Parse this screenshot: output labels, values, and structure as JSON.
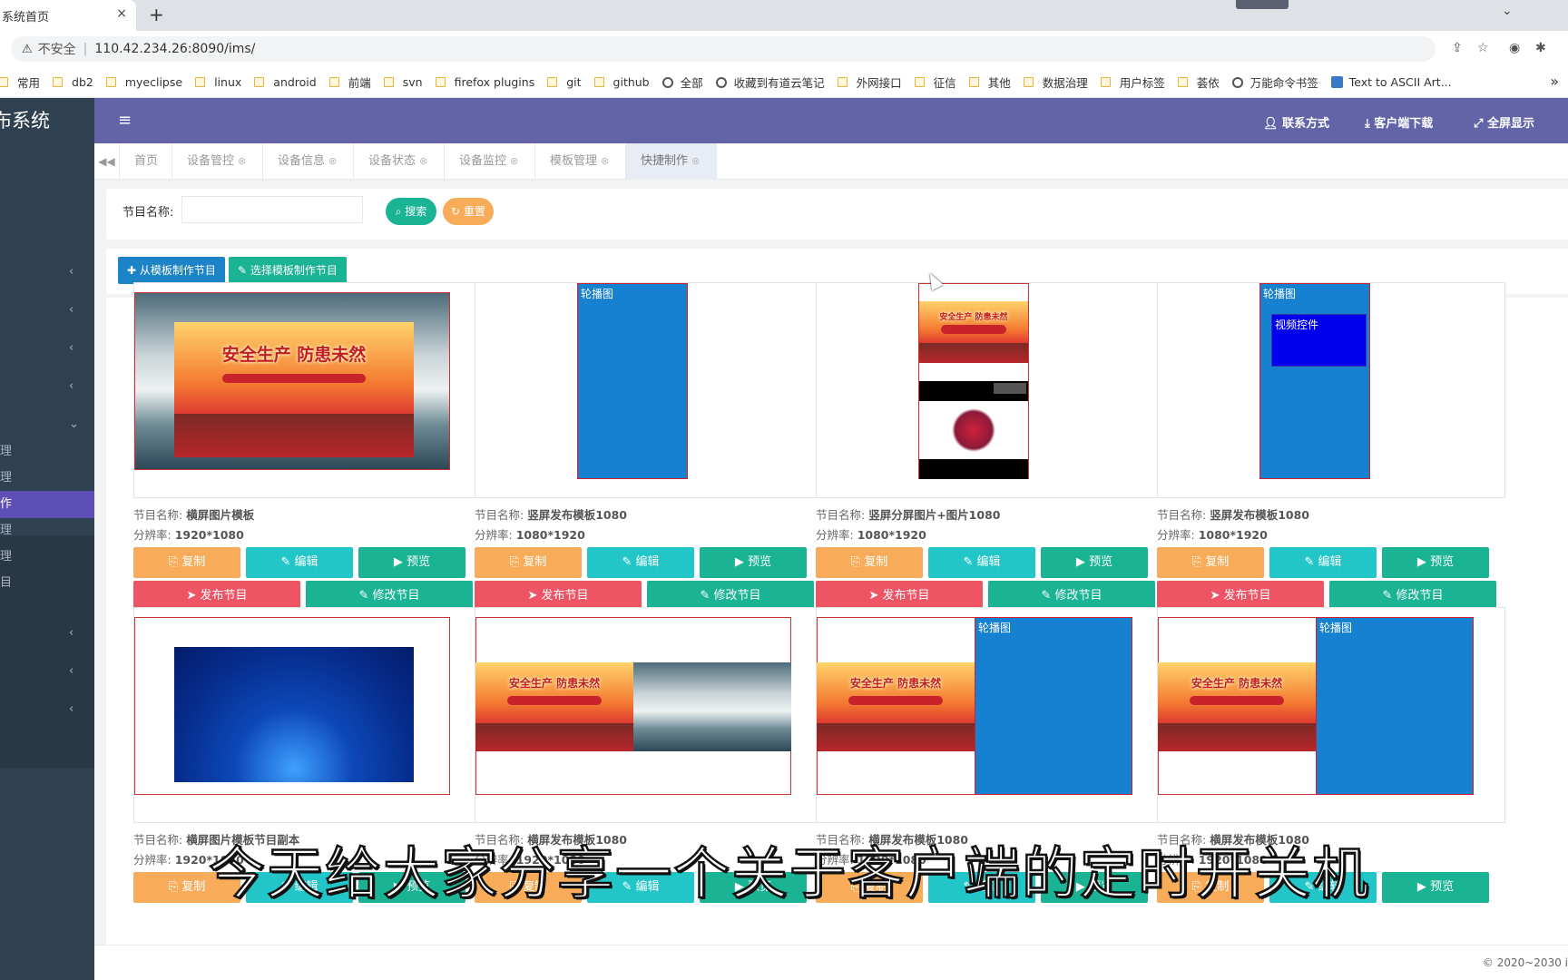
{
  "browser": {
    "tab_title": "系统首页",
    "tab_close": "×",
    "new_tab": "+",
    "win_caret": "⌄",
    "security": "不安全",
    "url": "110.42.234.26:8090/ims/",
    "bookmarks": [
      "常用",
      "db2",
      "myeclipse",
      "linux",
      "android",
      "前端",
      "svn",
      "firefox plugins",
      "git",
      "github",
      "全部",
      "收藏到有道云笔记",
      "外网接口",
      "征信",
      "其他",
      "数据治理",
      "用户标签",
      "荟依",
      "万能命令书签",
      "Text to ASCII Art..."
    ],
    "bookmark_types": [
      "folder",
      "folder",
      "folder",
      "folder",
      "folder",
      "folder",
      "folder",
      "folder",
      "folder",
      "folder",
      "globe",
      "globe",
      "folder",
      "folder",
      "folder",
      "folder",
      "folder",
      "folder",
      "globe",
      "special"
    ],
    "more": "»"
  },
  "sidebar": {
    "brand": "布系统",
    "chevrons": [
      "‹",
      "‹",
      "‹",
      "‹",
      "⌄",
      "‹",
      "‹",
      "‹"
    ],
    "sub_items": [
      "理",
      "理",
      "作",
      "理",
      "理",
      "目"
    ],
    "active_index": 2
  },
  "topbar": {
    "menu_icon": "≡",
    "contact": "联系方式",
    "download": "客户端下载",
    "fullscreen": "全屏显示"
  },
  "nav_tabs": {
    "back": "◀◀",
    "items": [
      {
        "label": "首页",
        "closable": false
      },
      {
        "label": "设备管控",
        "closable": true
      },
      {
        "label": "设备信息",
        "closable": true
      },
      {
        "label": "设备状态",
        "closable": true
      },
      {
        "label": "设备监控",
        "closable": true
      },
      {
        "label": "模板管理",
        "closable": true
      },
      {
        "label": "快捷制作",
        "closable": true,
        "active": true
      }
    ]
  },
  "search": {
    "label": "节目名称:",
    "placeholder": "",
    "search_btn": "搜索",
    "reset_btn": "重置"
  },
  "toolbar": {
    "from_template": "从模板制作节目",
    "choose_template": "选择模板制作节目"
  },
  "labels": {
    "name_prefix": "节目名称:",
    "res_prefix": "分辨率:",
    "copy": "复制",
    "edit": "编辑",
    "preview": "预览",
    "publish": "发布节目",
    "modify": "修改节目",
    "carousel": "轮播图",
    "video": "视频控件",
    "poster_title": "安全生产 防患未然"
  },
  "programs": [
    {
      "name": "横屏图片模板",
      "resolution": "1920*1080",
      "thumb": "poster-landscape"
    },
    {
      "name": "竖屏发布模板1080",
      "resolution": "1080*1920",
      "thumb": "vertical-carousel"
    },
    {
      "name": "竖屏分屏图片+图片1080",
      "resolution": "1080*1920",
      "thumb": "vertical-split"
    },
    {
      "name": "竖屏发布模板1080",
      "resolution": "1080*1920",
      "thumb": "vertical-carousel-video"
    },
    {
      "name": "横屏图片模板节目副本",
      "resolution": "1920*1080",
      "thumb": "deep-blue"
    },
    {
      "name": "横屏发布模板1080",
      "resolution": "1920*1080",
      "thumb": "poster-split-landscape"
    },
    {
      "name": "横屏发布模板1080",
      "resolution": "1920*1080",
      "thumb": "poster-carousel"
    },
    {
      "name": "横屏发布模板1080",
      "resolution": "1920*1080",
      "thumb": "poster-carousel"
    }
  ],
  "footer": "© 2020~2030 i",
  "subtitle": "今天给大家分享一个关于客户端的定时开关机",
  "colors": {
    "topbar": "#6264a7",
    "sidebar": "#2f4050",
    "active": "#5e4fb7",
    "orange": "#f8ac59",
    "cyan": "#23c6c8",
    "teal": "#1ab394",
    "red": "#ed5565"
  }
}
